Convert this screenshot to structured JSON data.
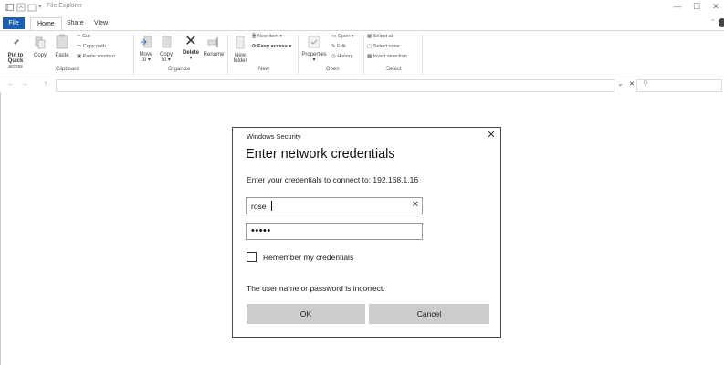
{
  "window": {
    "title": "File Explorer",
    "minimize": "—",
    "maximize": "☐",
    "close": "✕"
  },
  "tabs": {
    "file": "File",
    "home": "Home",
    "share": "Share",
    "view": "View"
  },
  "ribbon": {
    "clipboard": {
      "group_label": "Clipboard",
      "pin_line1": "Pin to Quick",
      "pin_line2": "access",
      "copy": "Copy",
      "paste": "Paste",
      "cut": "Cut",
      "copy_path": "Copy path",
      "paste_shortcut": "Paste shortcut"
    },
    "organize": {
      "group_label": "Organize",
      "move_to": "Move",
      "move_to2": "to ▾",
      "copy_to": "Copy",
      "copy_to2": "to ▾",
      "delete": "Delete",
      "delete2": "▾",
      "rename": "Rename"
    },
    "new": {
      "group_label": "New",
      "new_folder1": "New",
      "new_folder2": "folder",
      "new_item": "New item ▾",
      "easy_access": "Easy access ▾"
    },
    "open": {
      "group_label": "Open",
      "properties": "Properties",
      "properties2": "▾",
      "open": "Open ▾",
      "edit": "Edit",
      "history": "History"
    },
    "select": {
      "group_label": "Select",
      "select_all": "Select all",
      "select_none": "Select none",
      "invert": "Invert selection"
    }
  },
  "nav": {
    "back": "←",
    "forward": "→",
    "up": "↑",
    "dropdown": "⌄",
    "clear": "✕",
    "search_icon": "⚲"
  },
  "dialog": {
    "caption": "Windows Security",
    "close": "✕",
    "heading": "Enter network credentials",
    "description": "Enter your credentials to connect to: 192.168.1.16",
    "username_value": "rose",
    "username_clear": "✕",
    "password_value": "•••••",
    "remember_label": "Remember my credentials",
    "error": "The user name or password is incorrect.",
    "ok": "OK",
    "cancel": "Cancel"
  }
}
